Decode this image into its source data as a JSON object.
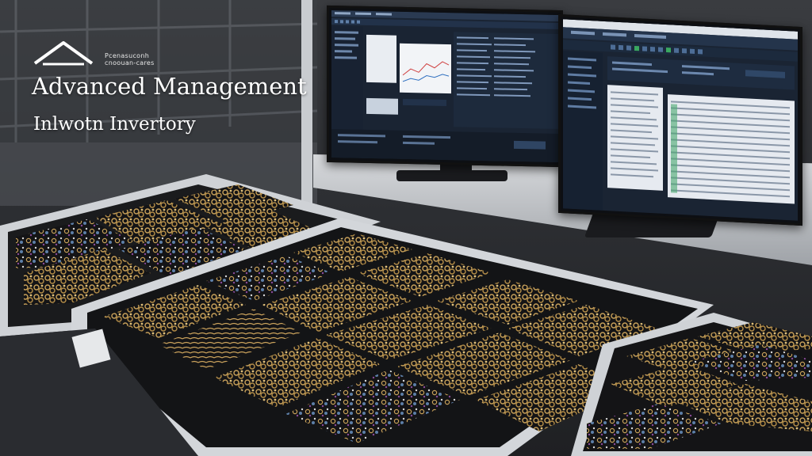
{
  "overlay": {
    "brand_tagline": "Pcenasuconh\ncnoouan-cares",
    "title": "Advanced Management",
    "subtitle": "Inlwotn Invertory"
  },
  "colors": {
    "background": "#2b2d31",
    "monitor_screen": "#1a2433",
    "spreadsheet_highlight": "#e6eaf0",
    "gold": "#c9a25a",
    "tray": "#161719"
  }
}
